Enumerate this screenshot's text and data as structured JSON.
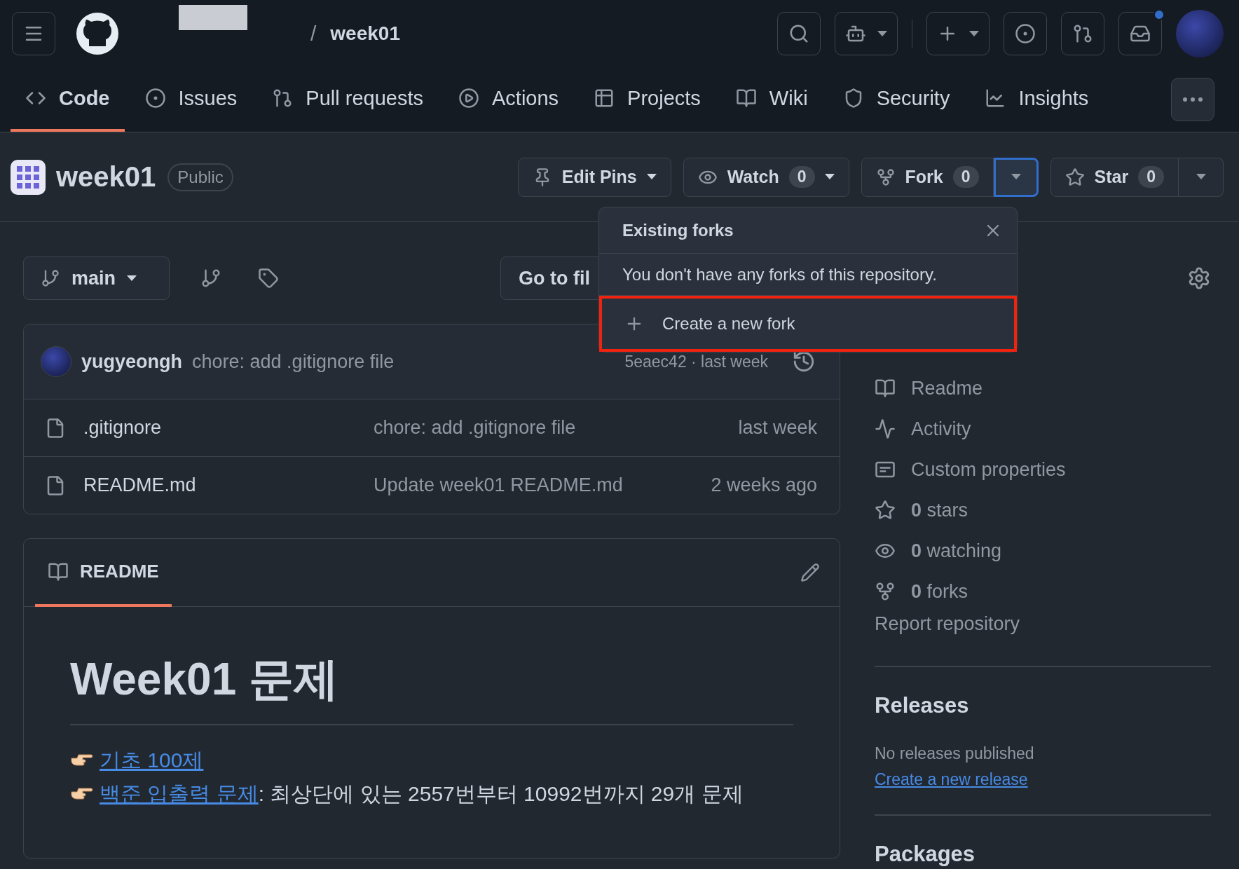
{
  "top_bar": {
    "separator": "/",
    "repo_name": "week01",
    "actions": [
      {
        "kind": "search",
        "split": false,
        "unread": false
      },
      {
        "kind": "copilot",
        "split": true,
        "unread": false
      },
      {
        "kind": "plus",
        "split": true,
        "unread": false
      },
      {
        "kind": "issue",
        "split": false,
        "unread": false
      },
      {
        "kind": "pull",
        "split": false,
        "unread": false
      },
      {
        "kind": "inbox",
        "split": false,
        "unread": true
      }
    ]
  },
  "repo_tabs": [
    {
      "label": "Code",
      "kind": "code",
      "selected": true
    },
    {
      "label": "Issues",
      "kind": "issue",
      "selected": false
    },
    {
      "label": "Pull requests",
      "kind": "pull",
      "selected": false
    },
    {
      "label": "Actions",
      "kind": "play",
      "selected": false
    },
    {
      "label": "Projects",
      "kind": "table",
      "selected": false
    },
    {
      "label": "Wiki",
      "kind": "book",
      "selected": false
    },
    {
      "label": "Security",
      "kind": "shield",
      "selected": false
    },
    {
      "label": "Insights",
      "kind": "graph",
      "selected": false
    }
  ],
  "repo_header": {
    "name": "week01",
    "visibility": "Public",
    "actions": [
      {
        "label": "Edit Pins",
        "kind": "pin",
        "split": false
      },
      {
        "label": "Watch",
        "count": "0",
        "kind": "eye",
        "split": false
      },
      {
        "label": "Fork",
        "count": "0",
        "kind": "fork",
        "split": true,
        "expanded": true
      },
      {
        "label": "Star",
        "count": "0",
        "kind": "star",
        "split": true,
        "expanded": false
      }
    ]
  },
  "fork_menu": {
    "title": "Existing forks",
    "message": "You don't have any forks of this repository.",
    "action": "Create a new fork",
    "highlighted": true
  },
  "code_toolbar": {
    "branch": "main",
    "go_to_file": "Go to fil"
  },
  "latest_commit": {
    "author": "yugyeongh",
    "message": "chore: add .gitignore file",
    "hash_time": "5eaec42 · last week"
  },
  "files": [
    {
      "name": ".gitignore",
      "commit": "chore: add .gitignore file",
      "time": "last week"
    },
    {
      "name": "README.md",
      "commit": "Update week01 README.md",
      "time": "2 weeks ago"
    }
  ],
  "readme": {
    "tab": "README",
    "heading": "Week01 문제",
    "lines": [
      {
        "link": "기초 100제"
      },
      {
        "link": "백준 입출력 문제",
        "text": ": 최상단에 있는 2557번부터 10992번까지 29개 문제"
      }
    ]
  },
  "sidebar": {
    "items": [
      {
        "kind": "book",
        "label": "Readme"
      },
      {
        "kind": "pulse",
        "label": "Activity"
      },
      {
        "kind": "properties",
        "label": "Custom properties"
      },
      {
        "kind": "star",
        "label": "**0** stars"
      },
      {
        "kind": "eye",
        "label": "**0** watching"
      },
      {
        "kind": "fork",
        "label": "**0** forks"
      }
    ],
    "report": "Report repository",
    "releases": {
      "title": "Releases",
      "empty": "No releases published",
      "link": "Create a new release"
    },
    "packages": {
      "title": "Packages"
    }
  }
}
